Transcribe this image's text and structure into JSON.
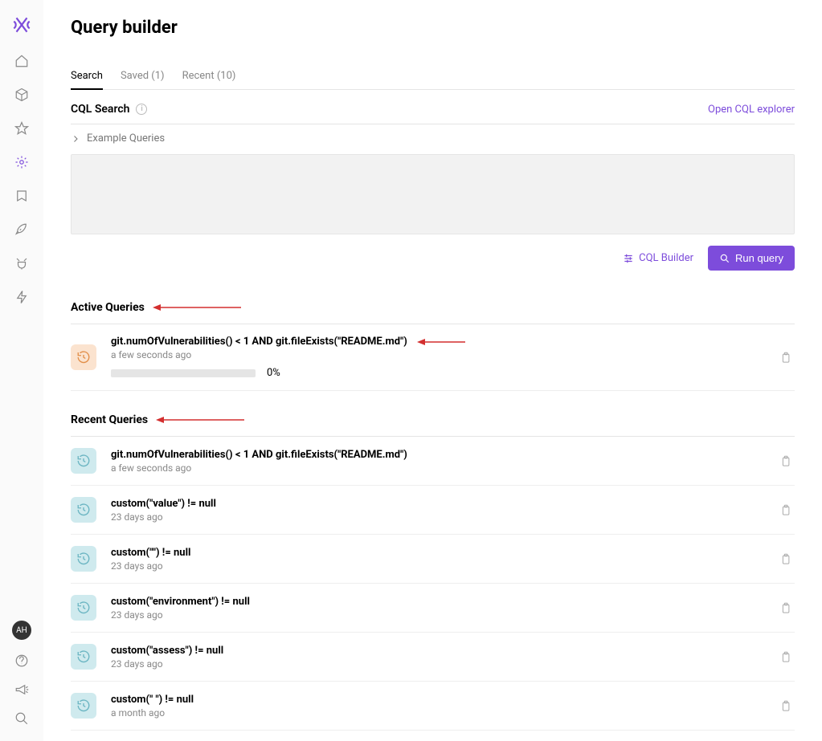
{
  "sidebar": {
    "avatar_initials": "AH"
  },
  "header": {
    "title": "Query builder"
  },
  "tabs": [
    {
      "label": "Search",
      "active": true
    },
    {
      "label": "Saved (1)"
    },
    {
      "label": "Recent (10)"
    }
  ],
  "cql": {
    "section_label": "CQL Search",
    "open_link": "Open CQL explorer",
    "example_label": "Example Queries",
    "builder_btn": "CQL Builder",
    "run_btn": "Run query"
  },
  "active_section_title": "Active Queries",
  "recent_section_title": "Recent Queries",
  "active_queries": [
    {
      "text": "git.numOfVulnerabilities() < 1 AND git.fileExists(\"README.md\")",
      "time": "a few seconds ago",
      "progress_label": "0%"
    }
  ],
  "recent_queries": [
    {
      "text": "git.numOfVulnerabilities() < 1 AND git.fileExists(\"README.md\")",
      "time": "a few seconds ago"
    },
    {
      "text": "custom(\"value\") != null",
      "time": "23 days ago"
    },
    {
      "text": "custom(\"\") != null",
      "time": "23 days ago"
    },
    {
      "text": "custom(\"environment\") != null",
      "time": "23 days ago"
    },
    {
      "text": "custom(\"assess\") != null",
      "time": "23 days ago"
    },
    {
      "text": "custom(\" \") != null",
      "time": "a month ago"
    }
  ]
}
